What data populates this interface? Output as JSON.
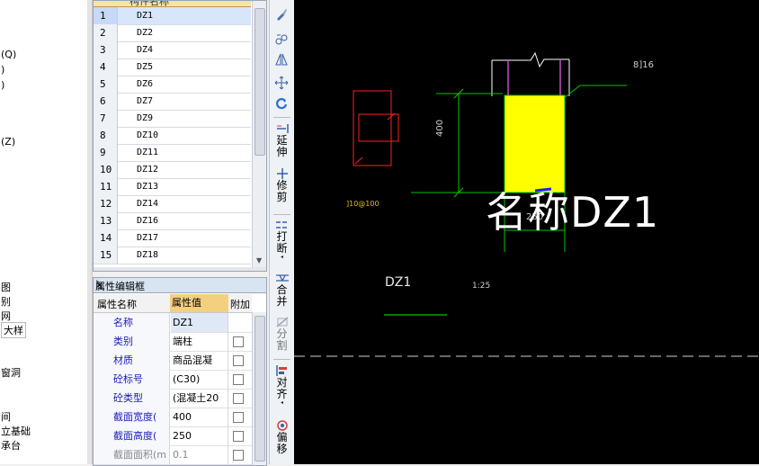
{
  "left_tree": {
    "fragments": [
      "(Q)",
      ")",
      ")",
      "(Z)",
      "图",
      "别",
      "网",
      "大样",
      "窗洞",
      "间",
      "立基础",
      "承台"
    ]
  },
  "component_list": {
    "header": "构件名称",
    "rows": [
      {
        "num": "1",
        "name": "DZ1",
        "selected": true
      },
      {
        "num": "2",
        "name": "DZ2"
      },
      {
        "num": "3",
        "name": "DZ4"
      },
      {
        "num": "4",
        "name": "DZ5"
      },
      {
        "num": "5",
        "name": "DZ6"
      },
      {
        "num": "6",
        "name": "DZ7"
      },
      {
        "num": "7",
        "name": "DZ9"
      },
      {
        "num": "8",
        "name": "DZ10"
      },
      {
        "num": "9",
        "name": "DZ11"
      },
      {
        "num": "10",
        "name": "DZ12"
      },
      {
        "num": "11",
        "name": "DZ13"
      },
      {
        "num": "12",
        "name": "DZ14"
      },
      {
        "num": "13",
        "name": "DZ16"
      },
      {
        "num": "14",
        "name": "DZ17"
      },
      {
        "num": "15",
        "name": "DZ18"
      }
    ]
  },
  "property_panel": {
    "title": "属性编辑框",
    "pin_glyph": "ᚢ",
    "close_glyph": "×",
    "col_name": "属性名称",
    "col_value": "属性值",
    "col_extra": "附加",
    "rows": [
      {
        "name": "名称",
        "value": "DZ1",
        "checkbox": false
      },
      {
        "name": "类别",
        "value": "端柱",
        "checkbox": true
      },
      {
        "name": "材质",
        "value": "商品混凝",
        "checkbox": true
      },
      {
        "name": "砼标号",
        "value": "(C30)",
        "checkbox": true
      },
      {
        "name": "砼类型",
        "value": "(混凝土20",
        "checkbox": true
      },
      {
        "name": "截面宽度(",
        "value": "400",
        "checkbox": true
      },
      {
        "name": "截面高度(",
        "value": "250",
        "checkbox": true
      },
      {
        "name": "截面面积(m",
        "value": "0.1",
        "checkbox": true,
        "gray": true
      }
    ]
  },
  "toolbar": {
    "extend": [
      "延",
      "伸"
    ],
    "trim": [
      "修",
      "剪"
    ],
    "break": [
      "打",
      "断"
    ],
    "merge": [
      "合",
      "并"
    ],
    "split": [
      "分",
      "割"
    ],
    "align": [
      "对",
      "齐"
    ],
    "offset": [
      "偏",
      "移"
    ]
  },
  "canvas": {
    "big_label": "名称DZ1",
    "rebar_top": "8]16",
    "dim_height": "400",
    "dim_width": "250",
    "stirrup": "]10@100",
    "section_name": "DZ1",
    "scale": "1:25",
    "colors": {
      "background": "#000000",
      "column_fill": "#ffff00",
      "dimension": "#00c800",
      "outline": "#ff0000",
      "stirrup": "#c050c0"
    }
  }
}
